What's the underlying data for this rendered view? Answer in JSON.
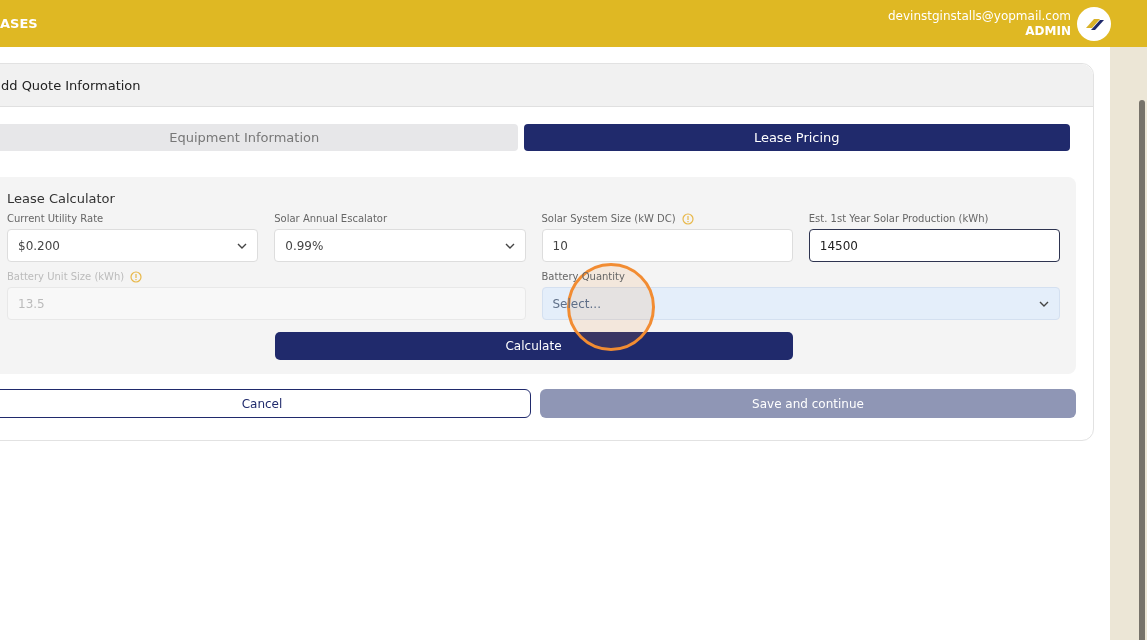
{
  "header": {
    "section": "ASES",
    "email": "devinstginstalls@yopmail.com",
    "role": "ADMIN"
  },
  "card": {
    "title": "dd Quote Information"
  },
  "tabs": [
    {
      "label": "Equipment Information",
      "selected": false
    },
    {
      "label": "Lease Pricing",
      "selected": true
    }
  ],
  "calculator": {
    "title": "Lease Calculator",
    "fields": [
      {
        "kind": "select",
        "label": "Current Utility Rate",
        "value": "$0.200",
        "info": false,
        "disabled": false,
        "focused": false,
        "highlighted": false
      },
      {
        "kind": "select",
        "label": "Solar Annual Escalator",
        "value": "0.99%",
        "info": false,
        "disabled": false,
        "focused": false,
        "highlighted": false
      },
      {
        "kind": "input",
        "label": "Solar System Size (kW DC)",
        "value": "10",
        "info": true,
        "disabled": false,
        "focused": false,
        "highlighted": false
      },
      {
        "kind": "input",
        "label": "Est. 1st Year Solar Production (kWh)",
        "value": "14500",
        "info": false,
        "disabled": false,
        "focused": true,
        "highlighted": false
      },
      {
        "kind": "input",
        "label": "Battery Unit Size (kWh)",
        "value": "13.5",
        "info": true,
        "disabled": true,
        "focused": false,
        "highlighted": false,
        "colspan": 2
      },
      {
        "kind": "select",
        "label": "Battery Quantity",
        "placeholder": "Select...",
        "info": false,
        "disabled": false,
        "focused": false,
        "highlighted": true,
        "colspan": 2
      }
    ],
    "calculate": "Calculate"
  },
  "buttons": [
    {
      "label": "Cancel",
      "kind": "outline",
      "disabled": false
    },
    {
      "label": "Save and continue",
      "kind": "primary",
      "disabled": true
    }
  ],
  "click_indicator": true
}
